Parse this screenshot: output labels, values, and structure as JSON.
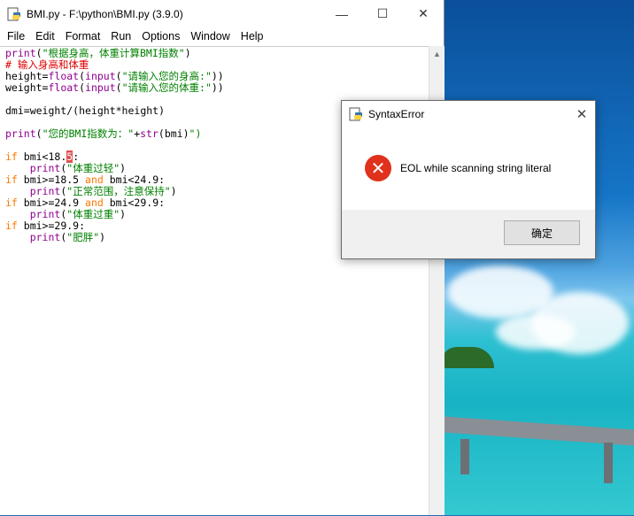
{
  "window": {
    "title": "BMI.py - F:\\python\\BMI.py (3.9.0)",
    "controls": {
      "minimize": "—",
      "maximize": "☐",
      "close": "✕"
    }
  },
  "menu": [
    "File",
    "Edit",
    "Format",
    "Run",
    "Options",
    "Window",
    "Help"
  ],
  "code": [
    "print(\"根据身高，体重计算BMI指数\")",
    "# 输入身高和体重",
    "height=float(input(\"请输入您的身高:\"))",
    "weight=float(input(\"请输入您的体重:\"))",
    "",
    "dmi=weight/(height*height)",
    "",
    "print(\"您的BMI指数为：\"+str(bmi)\")",
    "",
    "if bmi<18.5:",
    "    print(\"体重过轻\")",
    "if bmi>=18.5 and bmi<24.9:",
    "    print(\"正常范围，注意保持\")",
    "if bmi>=24.9 and bmi<29.9:",
    "    print(\"体重过重\")",
    "if bmi>=29.9:",
    "    print(\"肥胖\")"
  ],
  "dialog": {
    "title": "SyntaxError",
    "message": "EOL while scanning string literal",
    "ok_label": "确定",
    "close": "✕"
  },
  "icons": {
    "app": "python-idle-icon",
    "error": "error-x-icon"
  }
}
